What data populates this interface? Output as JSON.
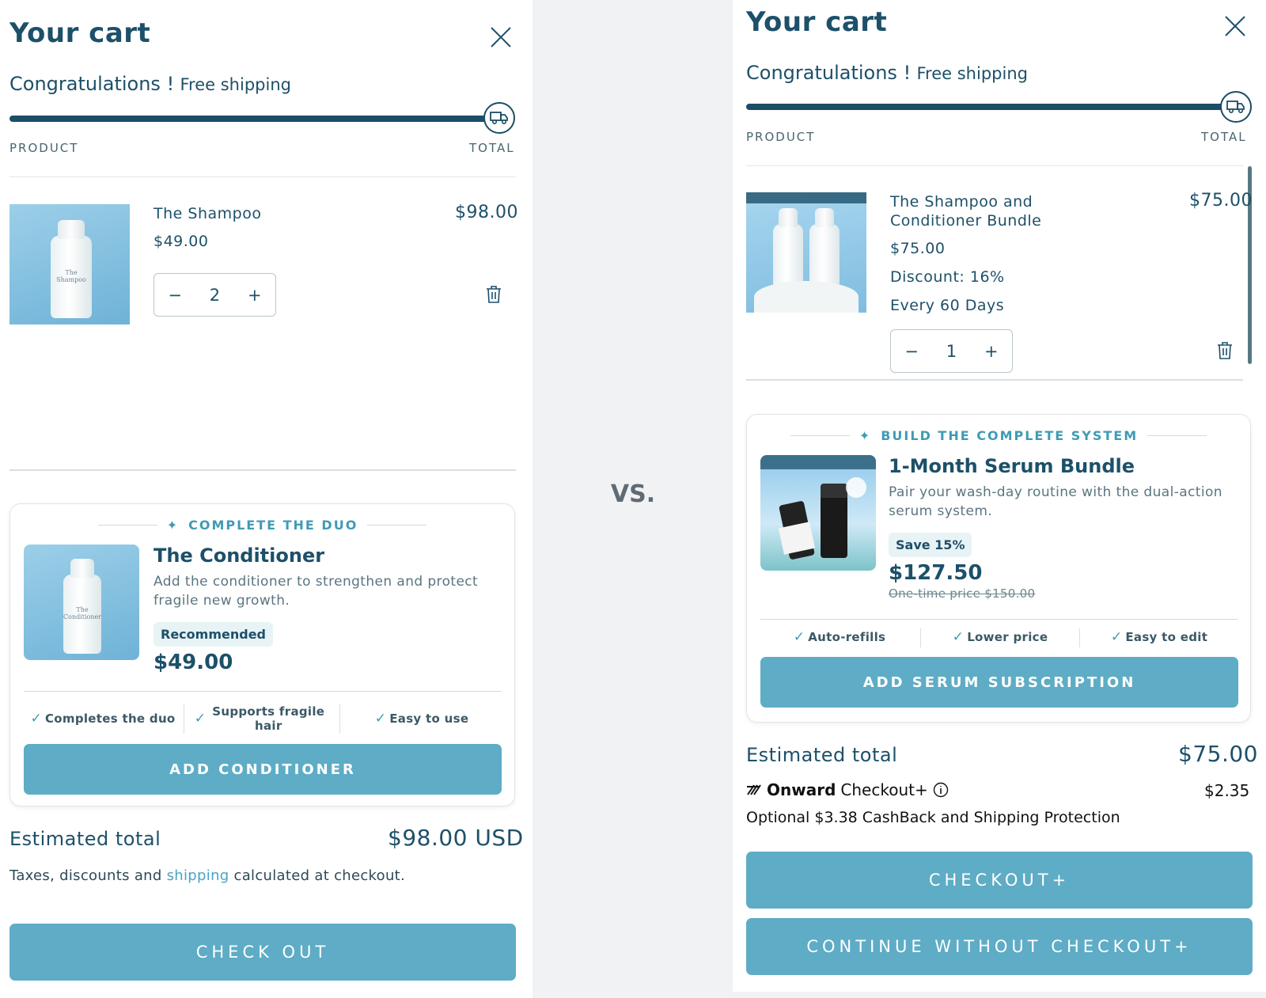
{
  "separator": "VS.",
  "left": {
    "title": "Your cart",
    "congrats_main": "Congratulations !",
    "congrats_sub": "Free shipping",
    "col_product": "PRODUCT",
    "col_total": "TOTAL",
    "item": {
      "name": "The Shampoo",
      "unit_price": "$49.00",
      "line_total": "$98.00",
      "qty": "2",
      "image_label": "The Shampoo"
    },
    "upsell": {
      "heading": "COMPLETE THE DUO",
      "title": "The Conditioner",
      "desc": "Add the conditioner to strengthen and protect fragile new growth.",
      "badge": "Recommended",
      "price": "$49.00",
      "image_label": "The Conditioner",
      "features": [
        "Completes the duo",
        "Supports fragile hair",
        "Easy to use"
      ],
      "button": "ADD CONDITIONER"
    },
    "estimated_label": "Estimated total",
    "estimated_value": "$98.00 USD",
    "note_before": "Taxes, discounts and ",
    "note_link": "shipping",
    "note_after": " calculated at checkout.",
    "checkout_button": "CHECK OUT"
  },
  "right": {
    "title": "Your cart",
    "congrats_main": "Congratulations !",
    "congrats_sub": "Free shipping",
    "col_product": "PRODUCT",
    "col_total": "TOTAL",
    "item": {
      "name": "The Shampoo and Conditioner Bundle",
      "unit_price": "$75.00",
      "discount": "Discount: 16%",
      "frequency": "Every 60 Days",
      "line_total": "$75.00",
      "qty": "1"
    },
    "upsell": {
      "heading": "BUILD THE COMPLETE SYSTEM",
      "title": "1-Month Serum Bundle",
      "desc": "Pair your wash-day routine with the dual-action serum system.",
      "badge": "Save 15%",
      "price": "$127.50",
      "strike": "One-time price $150.00",
      "features": [
        "Auto-refills",
        "Lower price",
        "Easy to edit"
      ],
      "button": "ADD SERUM SUBSCRIPTION"
    },
    "estimated_label": "Estimated total",
    "estimated_value": "$75.00",
    "onward_brand": "Onward",
    "onward_suffix": "Checkout+",
    "onward_price": "$2.35",
    "onward_note": "Optional $3.38 CashBack and Shipping Protection",
    "checkout_button": "CHECKOUT+",
    "continue_button": "CONTINUE WITHOUT CHECKOUT+"
  },
  "colors": {
    "brand_dark": "#1d5069",
    "accent": "#5eacc6",
    "link": "#4aa3c4"
  },
  "icons": [
    "close-icon",
    "truck-icon",
    "trash-icon",
    "sparkle-icon",
    "check-icon",
    "info-icon",
    "onward-logo-icon"
  ]
}
